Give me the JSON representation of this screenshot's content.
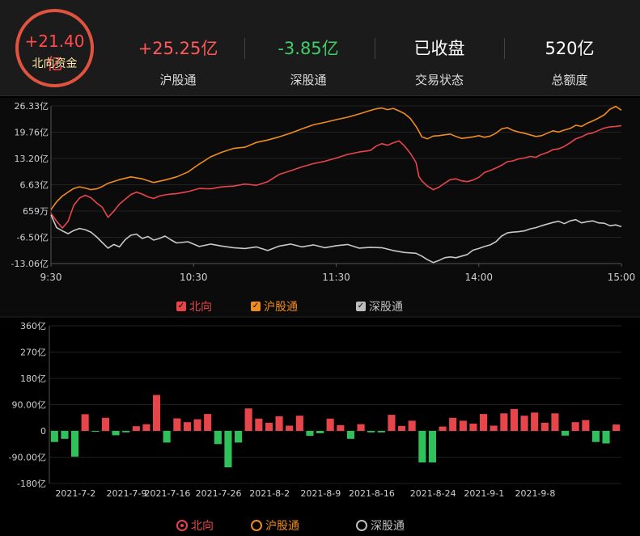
{
  "header": {
    "main_value": "+21.40亿",
    "main_label": "北向资金",
    "stats": [
      {
        "value": "+25.25亿",
        "label": "沪股通",
        "color": "#ff5a5a"
      },
      {
        "value": "-3.85亿",
        "label": "深股通",
        "color": "#3ecf6b"
      },
      {
        "value": "已收盘",
        "label": "交易状态",
        "color": "#ffffff"
      },
      {
        "value": "520亿",
        "label": "总额度",
        "color": "#ffffff"
      }
    ]
  },
  "colors": {
    "north": "#e8454a",
    "sh": "#f08b1d",
    "sz": "#c8c8c8",
    "up": "#e8454a",
    "down": "#2fc15a"
  },
  "legend_top": [
    {
      "label": "北向",
      "color": "#e8454a"
    },
    {
      "label": "沪股通",
      "color": "#f08b1d"
    },
    {
      "label": "深股通",
      "color": "#c0c0c0"
    }
  ],
  "legend_bottom": [
    {
      "label": "北向",
      "color": "#e8454a",
      "selected": true
    },
    {
      "label": "沪股通",
      "color": "#f08b1d",
      "selected": false
    },
    {
      "label": "深股通",
      "color": "#c0c0c0",
      "selected": false
    }
  ],
  "chart_data": [
    {
      "type": "line",
      "unit": "亿",
      "x_ticks": [
        "9:30",
        "10:30",
        "11:30",
        "14:00",
        "15:00"
      ],
      "y_ticks": [
        "26.33亿",
        "19.76亿",
        "13.20亿",
        "6.63亿",
        "659万",
        "-6.50亿",
        "-13.06亿"
      ],
      "ylim": [
        -13.06,
        26.33
      ],
      "series": [
        {
          "name": "北向",
          "points": [
            [
              0,
              -0.5
            ],
            [
              0.01,
              -2.5
            ],
            [
              0.02,
              -4.2
            ],
            [
              0.03,
              -2.5
            ],
            [
              0.04,
              1.5
            ],
            [
              0.05,
              3.3
            ],
            [
              0.06,
              4
            ],
            [
              0.07,
              3.4
            ],
            [
              0.08,
              2.1
            ],
            [
              0.09,
              1
            ],
            [
              0.1,
              -1.5
            ],
            [
              0.11,
              0
            ],
            [
              0.12,
              1.8
            ],
            [
              0.13,
              3
            ],
            [
              0.14,
              4.2
            ],
            [
              0.15,
              4.8
            ],
            [
              0.16,
              4.3
            ],
            [
              0.17,
              3.6
            ],
            [
              0.18,
              3.2
            ],
            [
              0.19,
              3.8
            ],
            [
              0.2,
              4.1
            ],
            [
              0.21,
              4.3
            ],
            [
              0.22,
              4.4
            ],
            [
              0.24,
              4.9
            ],
            [
              0.26,
              5.7
            ],
            [
              0.28,
              5.6
            ],
            [
              0.3,
              6.1
            ],
            [
              0.32,
              6.3
            ],
            [
              0.34,
              6.8
            ],
            [
              0.36,
              6.5
            ],
            [
              0.38,
              7.4
            ],
            [
              0.4,
              9.2
            ],
            [
              0.42,
              10.1
            ],
            [
              0.44,
              11.1
            ],
            [
              0.46,
              11.9
            ],
            [
              0.48,
              12.5
            ],
            [
              0.5,
              13.3
            ],
            [
              0.52,
              14.2
            ],
            [
              0.54,
              14.8
            ],
            [
              0.56,
              15.2
            ],
            [
              0.57,
              16.3
            ],
            [
              0.58,
              16.9
            ],
            [
              0.59,
              16.5
            ],
            [
              0.6,
              17.1
            ],
            [
              0.61,
              17.6
            ],
            [
              0.62,
              16.3
            ],
            [
              0.63,
              14.5
            ],
            [
              0.64,
              12.2
            ],
            [
              0.645,
              8.7
            ],
            [
              0.65,
              7.6
            ],
            [
              0.66,
              6.3
            ],
            [
              0.67,
              5.4
            ],
            [
              0.68,
              6
            ],
            [
              0.69,
              7
            ],
            [
              0.7,
              7.9
            ],
            [
              0.71,
              8.1
            ],
            [
              0.72,
              7.6
            ],
            [
              0.73,
              7.4
            ],
            [
              0.74,
              7.8
            ],
            [
              0.75,
              8.5
            ],
            [
              0.76,
              9.7
            ],
            [
              0.77,
              10.2
            ],
            [
              0.78,
              10.8
            ],
            [
              0.79,
              11.5
            ],
            [
              0.8,
              12.4
            ],
            [
              0.81,
              12.6
            ],
            [
              0.82,
              13.1
            ],
            [
              0.83,
              13.3
            ],
            [
              0.84,
              13.7
            ],
            [
              0.85,
              13.5
            ],
            [
              0.86,
              14.2
            ],
            [
              0.87,
              14.7
            ],
            [
              0.88,
              15.4
            ],
            [
              0.89,
              15.6
            ],
            [
              0.9,
              16.2
            ],
            [
              0.91,
              17.1
            ],
            [
              0.92,
              18.1
            ],
            [
              0.93,
              18.6
            ],
            [
              0.94,
              19.3
            ],
            [
              0.95,
              19.6
            ],
            [
              0.96,
              20.2
            ],
            [
              0.97,
              20.8
            ],
            [
              0.98,
              21.1
            ],
            [
              0.99,
              21.2
            ],
            [
              1,
              21.4
            ]
          ]
        },
        {
          "name": "沪股通",
          "points": [
            [
              0,
              0.4
            ],
            [
              0.01,
              2.4
            ],
            [
              0.02,
              3.8
            ],
            [
              0.03,
              4.8
            ],
            [
              0.04,
              5.7
            ],
            [
              0.05,
              6.1
            ],
            [
              0.06,
              5.8
            ],
            [
              0.07,
              5.4
            ],
            [
              0.08,
              5.6
            ],
            [
              0.09,
              6.2
            ],
            [
              0.1,
              7
            ],
            [
              0.12,
              7.9
            ],
            [
              0.14,
              8.6
            ],
            [
              0.16,
              8.1
            ],
            [
              0.18,
              7.2
            ],
            [
              0.2,
              7.8
            ],
            [
              0.22,
              8.6
            ],
            [
              0.24,
              9.8
            ],
            [
              0.26,
              11.8
            ],
            [
              0.28,
              13.6
            ],
            [
              0.3,
              14.8
            ],
            [
              0.32,
              15.7
            ],
            [
              0.34,
              16
            ],
            [
              0.36,
              17.2
            ],
            [
              0.38,
              17.8
            ],
            [
              0.4,
              18.6
            ],
            [
              0.42,
              19.5
            ],
            [
              0.44,
              20.6
            ],
            [
              0.46,
              21.6
            ],
            [
              0.48,
              22.2
            ],
            [
              0.5,
              22.9
            ],
            [
              0.52,
              23.5
            ],
            [
              0.54,
              24.3
            ],
            [
              0.56,
              25.2
            ],
            [
              0.57,
              25.6
            ],
            [
              0.58,
              25.8
            ],
            [
              0.59,
              25.4
            ],
            [
              0.6,
              25.7
            ],
            [
              0.61,
              25.1
            ],
            [
              0.62,
              24.4
            ],
            [
              0.63,
              23.2
            ],
            [
              0.64,
              21.2
            ],
            [
              0.645,
              20
            ],
            [
              0.65,
              18.6
            ],
            [
              0.66,
              18.1
            ],
            [
              0.67,
              18.8
            ],
            [
              0.68,
              18.9
            ],
            [
              0.69,
              19.1
            ],
            [
              0.7,
              19.3
            ],
            [
              0.71,
              18.7
            ],
            [
              0.72,
              18.2
            ],
            [
              0.73,
              18.4
            ],
            [
              0.74,
              18.6
            ],
            [
              0.75,
              18.9
            ],
            [
              0.76,
              18.5
            ],
            [
              0.77,
              18.8
            ],
            [
              0.78,
              19.5
            ],
            [
              0.79,
              20.6
            ],
            [
              0.8,
              20.9
            ],
            [
              0.81,
              20.2
            ],
            [
              0.82,
              19.8
            ],
            [
              0.83,
              19.5
            ],
            [
              0.84,
              19.1
            ],
            [
              0.85,
              18.7
            ],
            [
              0.86,
              18.9
            ],
            [
              0.87,
              19.5
            ],
            [
              0.88,
              20.1
            ],
            [
              0.89,
              19.8
            ],
            [
              0.9,
              20.3
            ],
            [
              0.91,
              20.7
            ],
            [
              0.92,
              21.5
            ],
            [
              0.93,
              21.2
            ],
            [
              0.94,
              22
            ],
            [
              0.95,
              22.6
            ],
            [
              0.96,
              23.3
            ],
            [
              0.97,
              24.1
            ],
            [
              0.98,
              25.5
            ],
            [
              0.99,
              26.2
            ],
            [
              1,
              25.25
            ]
          ]
        },
        {
          "name": "深股通",
          "points": [
            [
              0,
              -0.9
            ],
            [
              0.01,
              -4.1
            ],
            [
              0.02,
              -4.9
            ],
            [
              0.03,
              -5.6
            ],
            [
              0.04,
              -4.8
            ],
            [
              0.05,
              -4.3
            ],
            [
              0.06,
              -4.6
            ],
            [
              0.07,
              -5.2
            ],
            [
              0.08,
              -6.4
            ],
            [
              0.09,
              -7.8
            ],
            [
              0.1,
              -9.2
            ],
            [
              0.11,
              -8.3
            ],
            [
              0.12,
              -8.9
            ],
            [
              0.13,
              -7.1
            ],
            [
              0.14,
              -6
            ],
            [
              0.15,
              -5.7
            ],
            [
              0.16,
              -6.8
            ],
            [
              0.17,
              -6.3
            ],
            [
              0.18,
              -7.2
            ],
            [
              0.19,
              -6.8
            ],
            [
              0.2,
              -6.2
            ],
            [
              0.21,
              -7.1
            ],
            [
              0.22,
              -7.9
            ],
            [
              0.24,
              -7.6
            ],
            [
              0.26,
              -8.8
            ],
            [
              0.28,
              -8.2
            ],
            [
              0.3,
              -8.7
            ],
            [
              0.32,
              -9.1
            ],
            [
              0.34,
              -9.3
            ],
            [
              0.36,
              -8.9
            ],
            [
              0.38,
              -9.8
            ],
            [
              0.4,
              -8.7
            ],
            [
              0.42,
              -8.2
            ],
            [
              0.44,
              -8.9
            ],
            [
              0.46,
              -8.4
            ],
            [
              0.48,
              -9.1
            ],
            [
              0.5,
              -8.6
            ],
            [
              0.52,
              -8.3
            ],
            [
              0.54,
              -9.2
            ],
            [
              0.56,
              -9
            ],
            [
              0.58,
              -9.1
            ],
            [
              0.6,
              -9.8
            ],
            [
              0.62,
              -10.3
            ],
            [
              0.64,
              -10.5
            ],
            [
              0.65,
              -11.2
            ],
            [
              0.66,
              -12.1
            ],
            [
              0.67,
              -12.8
            ],
            [
              0.68,
              -12.3
            ],
            [
              0.69,
              -11.6
            ],
            [
              0.7,
              -11.4
            ],
            [
              0.71,
              -11.6
            ],
            [
              0.72,
              -11.2
            ],
            [
              0.73,
              -10.8
            ],
            [
              0.74,
              -9.7
            ],
            [
              0.75,
              -9.3
            ],
            [
              0.76,
              -8.8
            ],
            [
              0.77,
              -8.4
            ],
            [
              0.78,
              -7.6
            ],
            [
              0.79,
              -6.2
            ],
            [
              0.8,
              -5.4
            ],
            [
              0.81,
              -5.2
            ],
            [
              0.82,
              -5.1
            ],
            [
              0.83,
              -4.9
            ],
            [
              0.84,
              -4.4
            ],
            [
              0.85,
              -4.1
            ],
            [
              0.86,
              -3.6
            ],
            [
              0.87,
              -3.2
            ],
            [
              0.88,
              -2.8
            ],
            [
              0.89,
              -2.5
            ],
            [
              0.9,
              -3.1
            ],
            [
              0.91,
              -2.4
            ],
            [
              0.92,
              -2.1
            ],
            [
              0.93,
              -2.9
            ],
            [
              0.94,
              -2.6
            ],
            [
              0.95,
              -2.4
            ],
            [
              0.96,
              -2.9
            ],
            [
              0.97,
              -3
            ],
            [
              0.98,
              -3.6
            ],
            [
              0.99,
              -3.4
            ],
            [
              1,
              -3.85
            ]
          ]
        }
      ]
    },
    {
      "type": "bar",
      "unit": "亿",
      "name": "北向",
      "y_ticks": [
        "360亿",
        "270亿",
        "180亿",
        "90.00亿",
        "0",
        "-90.00亿",
        "-180亿"
      ],
      "ylim": [
        -180,
        360
      ],
      "x_labels": [
        "2021-7-2",
        "2021-7-9",
        "2021-7-16",
        "2021-7-26",
        "2021-8-2",
        "2021-8-9",
        "2021-8-16",
        "2021-8-24",
        "2021-9-1",
        "2021-9-8"
      ],
      "values": [
        -38,
        -27,
        -88,
        57,
        -3,
        45,
        -15,
        -5,
        16,
        23,
        123,
        -40,
        43,
        30,
        40,
        58,
        -45,
        -125,
        -40,
        77,
        42,
        28,
        50,
        18,
        52,
        -17,
        -8,
        42,
        20,
        -27,
        23,
        -5,
        -5,
        55,
        17,
        35,
        -108,
        -108,
        15,
        45,
        35,
        25,
        58,
        18,
        60,
        75,
        52,
        63,
        28,
        60,
        -16,
        30,
        37,
        -38,
        -43,
        22
      ]
    }
  ]
}
